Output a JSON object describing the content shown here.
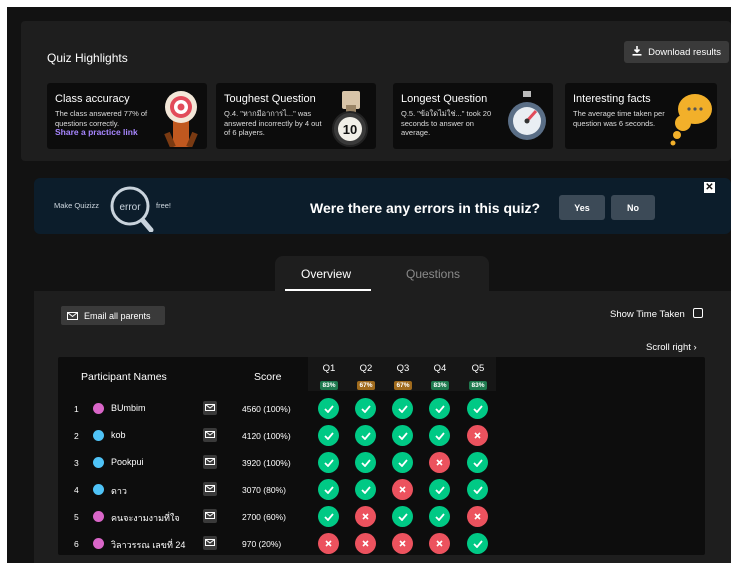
{
  "highlights": {
    "title": "Quiz Highlights",
    "download_label": "Download results",
    "cards": [
      {
        "title": "Class accuracy",
        "text": "The class answered 77% of questions correctly.",
        "link": "Share a practice link"
      },
      {
        "title": "Toughest Question",
        "text": "Q.4. \"หากมีอาการไ...\" was answered incorrectly by 4 out of 6 players.",
        "badge": "10"
      },
      {
        "title": "Longest Question",
        "text": "Q.5. \"ข้อใดไม่ใช่...\" took 20 seconds to answer on average."
      },
      {
        "title": "Interesting facts",
        "text": "The average time taken per question was 6 seconds."
      }
    ]
  },
  "banner": {
    "make": "Make Quizizz",
    "lens_word": "error",
    "free": "free!",
    "question": "Were there any errors in this quiz?",
    "yes": "Yes",
    "no": "No",
    "close": "✕"
  },
  "tabs": {
    "overview": "Overview",
    "questions": "Questions"
  },
  "panel": {
    "email_all": "Email all parents",
    "show_time": "Show Time Taken",
    "scroll_right": "Scroll right"
  },
  "table": {
    "header_name": "Participant Names",
    "header_score": "Score",
    "questions": [
      {
        "label": "Q1",
        "pct": "83%",
        "color": "#1f7a4f"
      },
      {
        "label": "Q2",
        "pct": "67%",
        "color": "#a06b1d"
      },
      {
        "label": "Q3",
        "pct": "67%",
        "color": "#a06b1d"
      },
      {
        "label": "Q4",
        "pct": "83%",
        "color": "#1f7a4f"
      },
      {
        "label": "Q5",
        "pct": "83%",
        "color": "#1f7a4f"
      }
    ],
    "rows": [
      {
        "num": "1",
        "name": "BUmbim",
        "score": "4560 (100%)",
        "avatar": "#d966c8",
        "answers": [
          1,
          1,
          1,
          1,
          1
        ]
      },
      {
        "num": "2",
        "name": "kob",
        "score": "4120 (100%)",
        "avatar": "#4fc3f7",
        "answers": [
          1,
          1,
          1,
          1,
          0
        ]
      },
      {
        "num": "3",
        "name": "Pookpui",
        "score": "3920 (100%)",
        "avatar": "#4fc3f7",
        "answers": [
          1,
          1,
          1,
          0,
          1
        ]
      },
      {
        "num": "4",
        "name": "ดาว",
        "score": "3070 (80%)",
        "avatar": "#4fc3f7",
        "answers": [
          1,
          1,
          0,
          1,
          1
        ]
      },
      {
        "num": "5",
        "name": "คนจะงามงามที่ใจ",
        "score": "2700 (60%)",
        "avatar": "#d966c8",
        "answers": [
          1,
          0,
          1,
          1,
          0
        ]
      },
      {
        "num": "6",
        "name": "วิลาวรรณ เลขที่ 24",
        "score": "970 (20%)",
        "avatar": "#d966c8",
        "answers": [
          0,
          0,
          0,
          0,
          1
        ]
      }
    ]
  }
}
